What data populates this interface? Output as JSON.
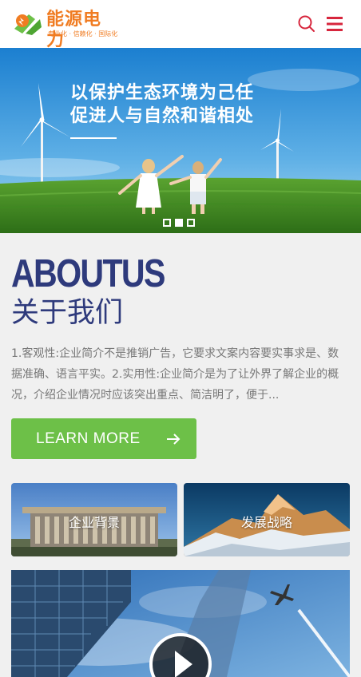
{
  "header": {
    "logo_title": "能源电力",
    "logo_slogan": "专业化 · 信赖化 · 国际化",
    "brand_color": "#f07c22",
    "accent_color": "#d7263d",
    "search_icon": "search-icon",
    "menu_icon": "hamburger-menu-icon"
  },
  "banner": {
    "line1": "以保护生态环境为己任",
    "line2": "促进人与自然和谐相处",
    "slide_count": 3,
    "active_slide": 2
  },
  "about": {
    "title_en": "ABOUTUS",
    "title_cn": "关于我们",
    "description": "1.客观性:企业简介不是推销广告，它要求文案内容要实事求是、数据准确、语言平实。2.实用性:企业简介是为了让外界了解企业的概况，介绍企业情况时应该突出重点、简洁明了，便于...",
    "button_label": "LEARN MORE",
    "button_color": "#6dc048",
    "title_color": "#2e3a7c"
  },
  "cards": [
    {
      "label": "企业背景"
    },
    {
      "label": "发展战略"
    }
  ],
  "video": {
    "play_icon": "play-icon"
  }
}
